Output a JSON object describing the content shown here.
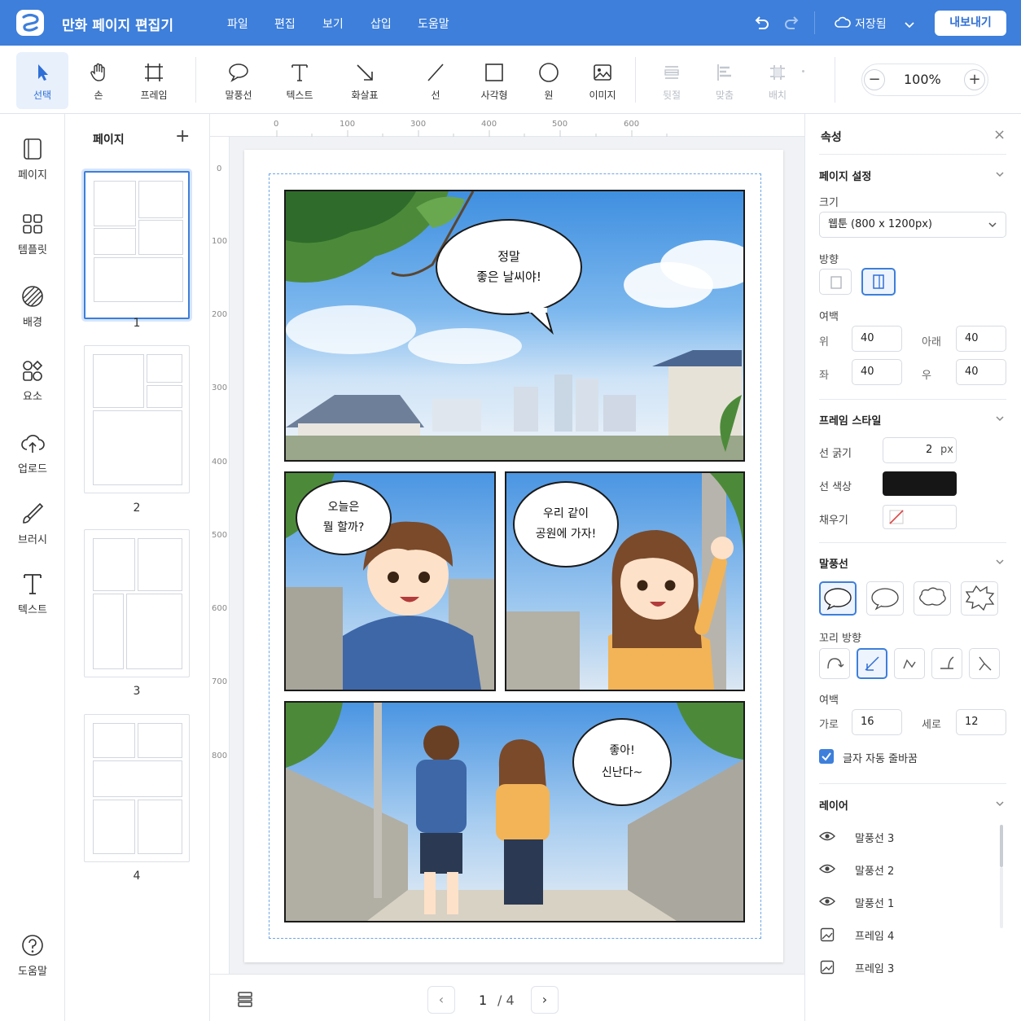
{
  "app": {
    "title": "만화 페이지 편집기",
    "save_status": "저장됨",
    "export_label": "내보내기"
  },
  "menu": [
    "파일",
    "편집",
    "보기",
    "삽입",
    "도움말"
  ],
  "tools": [
    {
      "label": "선택",
      "icon": "cursor-icon",
      "active": true
    },
    {
      "label": "손",
      "icon": "hand-icon"
    },
    {
      "label": "프레임",
      "icon": "frame-icon"
    },
    {
      "label": "말풍선",
      "icon": "speech-bubble-icon"
    },
    {
      "label": "텍스트",
      "icon": "text-icon"
    },
    {
      "label": "화살표",
      "icon": "arrow-icon"
    },
    {
      "label": "선",
      "icon": "line-icon"
    },
    {
      "label": "사각형",
      "icon": "rectangle-icon"
    },
    {
      "label": "원",
      "icon": "circle-icon"
    },
    {
      "label": "이미지",
      "icon": "image-icon"
    },
    {
      "label": "뒷절",
      "icon": "layer-order-icon",
      "disabled": true
    },
    {
      "label": "맞춤",
      "icon": "align-icon",
      "disabled": true
    },
    {
      "label": "배치",
      "icon": "distribute-icon",
      "disabled": true
    }
  ],
  "zoom": {
    "value": "100%",
    "minus": "−",
    "plus": "+"
  },
  "sidebar": [
    {
      "label": "페이지",
      "icon": "page-icon"
    },
    {
      "label": "템플릿",
      "icon": "template-grid-icon"
    },
    {
      "label": "배경",
      "icon": "background-icon"
    },
    {
      "label": "요소",
      "icon": "elements-icon"
    },
    {
      "label": "업로드",
      "icon": "upload-cloud-icon"
    },
    {
      "label": "브러시",
      "icon": "brush-icon"
    },
    {
      "label": "텍스트",
      "icon": "text-tool-icon"
    }
  ],
  "help_label": "도움말",
  "pages_panel": {
    "title": "페이지",
    "add": "+",
    "pages": [
      "1",
      "2",
      "3",
      "4"
    ]
  },
  "ruler": {
    "top": [
      "0",
      "100",
      "300",
      "400",
      "500",
      "600"
    ],
    "left": [
      "0",
      "100",
      "200",
      "300",
      "400",
      "500",
      "600",
      "700",
      "800"
    ]
  },
  "comic": {
    "bubble1": [
      "정말",
      "좋은 날씨야!"
    ],
    "bubble2": [
      "오늘은",
      "뭘 할까?"
    ],
    "bubble3": [
      "우리 같이",
      "공원에 가자!"
    ],
    "bubble4": [
      "좋아!",
      "신난다~"
    ]
  },
  "pager": {
    "current": "1",
    "total": "/ 4",
    "prev": "‹",
    "next": "›"
  },
  "props": {
    "title": "속성",
    "close": "×",
    "page_settings": {
      "title": "페이지 설정",
      "size_label": "크기",
      "size_value": "웹툰 (800 x 1200px)",
      "orientation_label": "방향",
      "margin_label": "여백",
      "top_label": "위",
      "top": "40",
      "bottom_label": "아래",
      "bottom": "40",
      "left_label": "좌",
      "left": "40",
      "right_label": "우",
      "right": "40"
    },
    "frame_style": {
      "title": "프레임 스타일",
      "stroke_width_label": "선 굵기",
      "stroke_width": "2",
      "unit": "px",
      "stroke_color_label": "선 색상",
      "stroke_color": "#161616",
      "fill_label": "채우기"
    },
    "bubble": {
      "title": "말풍선",
      "tail_label": "꼬리 방향",
      "padding_label": "여백",
      "h_label": "가로",
      "h": "16",
      "v_label": "세로",
      "v": "12",
      "autowrap_label": "글자 자동 줄바꿈"
    },
    "layers": {
      "title": "레이어",
      "items": [
        {
          "name": "말풍선 3",
          "icon": "eye-icon"
        },
        {
          "name": "말풍선 2",
          "icon": "eye-icon"
        },
        {
          "name": "말풍선 1",
          "icon": "eye-icon"
        },
        {
          "name": "프레임 4",
          "icon": "frame-image-icon"
        },
        {
          "name": "프레임 3",
          "icon": "frame-image-icon"
        }
      ]
    }
  },
  "colors": {
    "accent": "#3d7fdb",
    "titlebar": "#3d7fdb"
  }
}
